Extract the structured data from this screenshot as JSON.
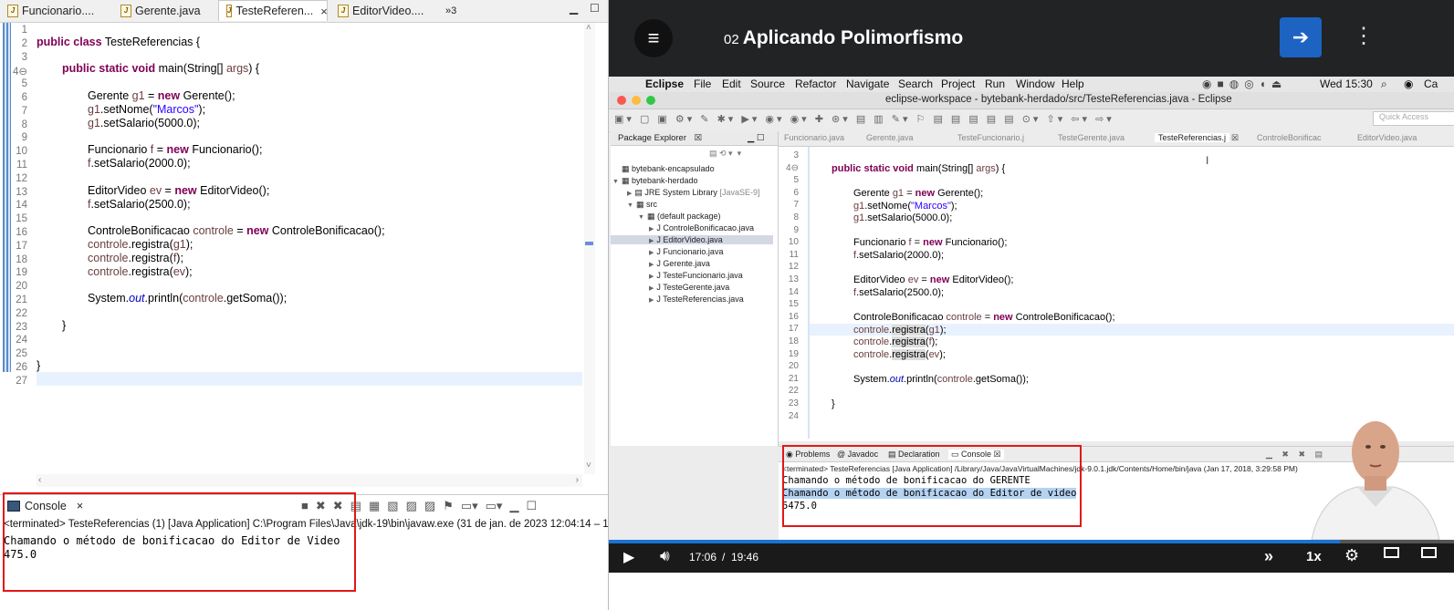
{
  "left": {
    "tabs": [
      {
        "label": "Funcionario...."
      },
      {
        "label": "Gerente.java"
      },
      {
        "label": "TesteReferen...",
        "close": "×"
      },
      {
        "label": "EditorVideo...."
      }
    ],
    "tab_overflow": "»3",
    "line_numbers": [
      "1",
      "2",
      "3",
      "4⊖",
      "5",
      "6",
      "7",
      "8",
      "9",
      "10",
      "11",
      "12",
      "13",
      "14",
      "15",
      "16",
      "17",
      "18",
      "19",
      "20",
      "21",
      "22",
      "23",
      "24",
      "25",
      "26",
      "27"
    ],
    "console": {
      "tab_label": "Console",
      "close": "×",
      "terminated": "<terminated> TesteReferencias (1) [Java Application] C:\\Program Files\\Java\\jdk-19\\bin\\javaw.exe  (31 de jan. de 2023 12:04:14 – 1",
      "output": [
        "Chamando o método de bonificacao do Editor de Video",
        "475.0"
      ]
    }
  },
  "video": {
    "header": {
      "lesson_number": "02",
      "lesson_title": "Aplicando Polimorfismo"
    },
    "macbar": {
      "app": "Eclipse",
      "menus": [
        "File",
        "Edit",
        "Source",
        "Refactor",
        "Navigate",
        "Search",
        "Project",
        "Run",
        "Window",
        "Help"
      ],
      "clock": "Wed 15:30",
      "user_partial": "Ca"
    },
    "window_title": "eclipse-workspace - bytebank-herdado/src/TesteReferencias.java - Eclipse",
    "quick_access": "Quick Access",
    "package_explorer": {
      "title": "Package Explorer",
      "close": "☒",
      "items": [
        {
          "label": "bytebank-encapsulado"
        },
        {
          "label": "bytebank-herdado"
        },
        {
          "label": "JRE System Library",
          "suffix": "[JavaSE-9]"
        },
        {
          "label": "src"
        },
        {
          "label": "(default package)"
        },
        {
          "label": "ControleBonificacao.java"
        },
        {
          "label": "EditorVideo.java"
        },
        {
          "label": "Funcionario.java"
        },
        {
          "label": "Gerente.java"
        },
        {
          "label": "TesteFuncionario.java"
        },
        {
          "label": "TesteGerente.java"
        },
        {
          "label": "TesteReferencias.java"
        }
      ]
    },
    "editor_tabs": [
      "Funcionario.java",
      "Gerente.java",
      "TesteFuncionario.j",
      "TesteGerente.java",
      "TesteReferencias.j",
      "ControleBonificac",
      "EditorVideo.java"
    ],
    "line_numbers": [
      "3",
      "4⊖",
      "5",
      "6",
      "7",
      "8",
      "9",
      "10",
      "11",
      "12",
      "13",
      "14",
      "15",
      "16",
      "17",
      "18",
      "19",
      "20",
      "21",
      "22",
      "23",
      "24"
    ],
    "console": {
      "tabs": [
        "Problems",
        "Javadoc",
        "Declaration",
        "Console"
      ],
      "terminated": "<terminated> TesteReferencias [Java Application] /Library/Java/JavaVirtualMachines/jdk-9.0.1.jdk/Contents/Home/bin/java (Jan 17, 2018, 3:29:58 PM)",
      "output": [
        "Chamando o método de bonificacao do GERENTE",
        "Chamando o método de bonificacao do Editor de video",
        "5475.0"
      ]
    },
    "player": {
      "current_time": "17:06",
      "separator": "/",
      "total_time": "19:46",
      "speed": "1x",
      "progress_fraction": 0.865
    }
  },
  "colors": {
    "accent_blue": "#1c63c2",
    "highlight_box": "#e31616",
    "header_bg": "#222325"
  }
}
